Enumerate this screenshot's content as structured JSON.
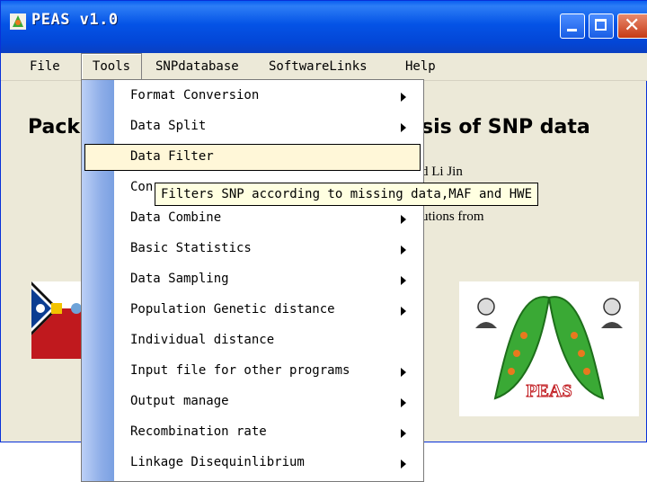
{
  "window": {
    "title": "PEAS v1.0"
  },
  "menubar": {
    "items": [
      {
        "label": "File"
      },
      {
        "label": "Tools"
      },
      {
        "label": "SNPdatabase"
      },
      {
        "label": "SoftwareLinks"
      },
      {
        "label": "Help"
      }
    ]
  },
  "main": {
    "headline_left": "Pack",
    "headline_right": "sis of SNP data",
    "credit_line1": "d Li Jin",
    "credit_line2": "utions from",
    "logo_right_text": "PEAS"
  },
  "tools_menu": {
    "items": [
      {
        "label": "Format Conversion",
        "submenu": true
      },
      {
        "label": "Data Split",
        "submenu": true
      },
      {
        "label": "Data Filter",
        "submenu": false,
        "selected": true
      },
      {
        "label": "Con",
        "submenu": true
      },
      {
        "label": "Data Combine",
        "submenu": true
      },
      {
        "label": "Basic Statistics",
        "submenu": true
      },
      {
        "label": "Data Sampling",
        "submenu": true
      },
      {
        "label": "Population Genetic distance",
        "submenu": true
      },
      {
        "label": "Individual distance",
        "submenu": false
      },
      {
        "label": "Input file for other programs",
        "submenu": true
      },
      {
        "label": "Output manage",
        "submenu": true
      },
      {
        "label": "Recombination rate",
        "submenu": true
      },
      {
        "label": "Linkage Disequinlibrium",
        "submenu": true
      }
    ]
  },
  "tooltip": {
    "text": "Filters SNP according to missing data,MAF and HWE"
  },
  "colors": {
    "titlebar": "#0453e6",
    "window_bg": "#ece9d8",
    "close_button": "#c63a16",
    "menu_strip": "#8eaee8",
    "tooltip_bg": "#ffffe1",
    "logo_green": "#3aa935",
    "logo_orange": "#e8791e"
  }
}
